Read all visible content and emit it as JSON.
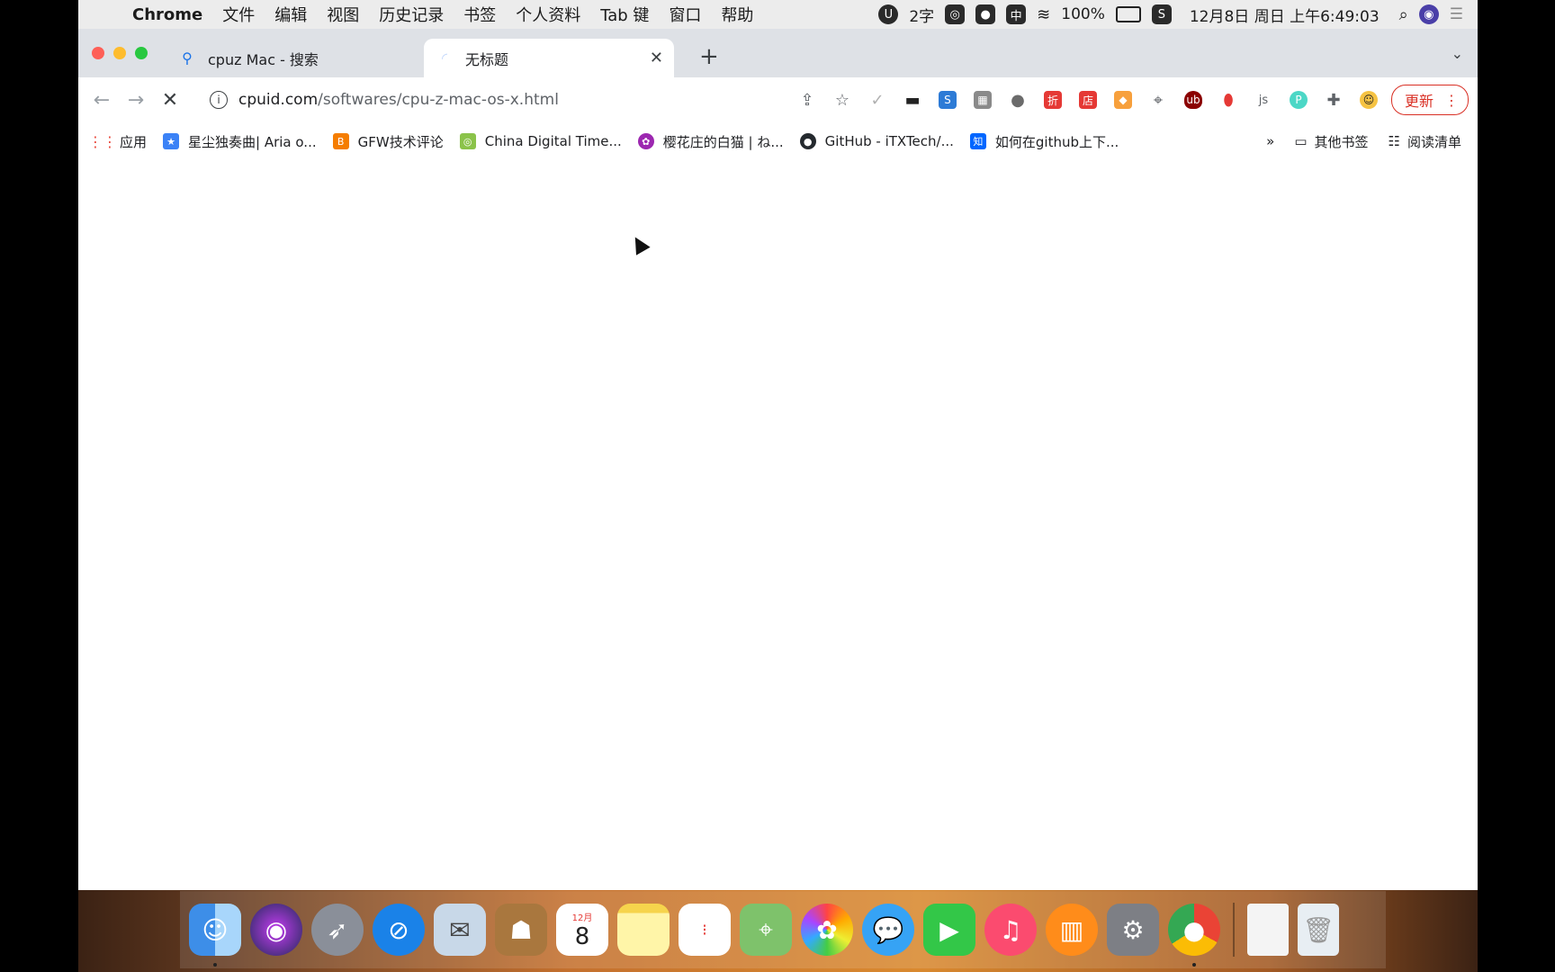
{
  "menubar": {
    "app": "Chrome",
    "items": [
      "文件",
      "编辑",
      "视图",
      "历史记录",
      "书签",
      "个人资料",
      "Tab 键",
      "窗口",
      "帮助"
    ],
    "status": {
      "wordcount": "2字",
      "input_method": "中",
      "battery": "100%",
      "datetime": "12月8日 周日 上午6:49:03"
    }
  },
  "tabs": [
    {
      "title": "cpuz Mac - 搜索",
      "icon": "search-icon",
      "active": false
    },
    {
      "title": "无标题",
      "icon": "loading-icon",
      "active": true
    }
  ],
  "toolbar": {
    "url_host": "cpuid.com",
    "url_path": "/softwares/cpu-z-mac-os-x.html",
    "update_label": "更新"
  },
  "bookmarks": {
    "items": [
      {
        "label": "应用",
        "icon": "apps-grid-icon",
        "color": "#e94235"
      },
      {
        "label": "星尘独奏曲| Aria o...",
        "icon": "anime-icon",
        "color": "#3b82f6"
      },
      {
        "label": "GFW技术评论",
        "icon": "blogger-icon",
        "color": "#f57d00"
      },
      {
        "label": "China Digital Time...",
        "icon": "cdt-icon",
        "color": "#8bc34a"
      },
      {
        "label": "樱花庄的白猫 | ね...",
        "icon": "sakura-icon",
        "color": "#9c27b0"
      },
      {
        "label": "GitHub - iTXTech/...",
        "icon": "github-icon",
        "color": "#24292e"
      },
      {
        "label": "如何在github上下...",
        "icon": "zhihu-icon",
        "color": "#0066ff"
      }
    ],
    "other_label": "其他书签",
    "reading_list_label": "阅读清单"
  },
  "dock": {
    "apps": [
      {
        "name": "finder-icon",
        "color": "#3d8ee8",
        "running": true
      },
      {
        "name": "siri-icon",
        "color": "#222a5a",
        "running": false
      },
      {
        "name": "launchpad-icon",
        "color": "#8a8f99",
        "running": false
      },
      {
        "name": "safari-icon",
        "color": "#1a82e8",
        "running": false
      },
      {
        "name": "mail-icon",
        "color": "#c8d8e8",
        "running": false
      },
      {
        "name": "contacts-icon",
        "color": "#a9773e",
        "running": false
      },
      {
        "name": "calendar-icon",
        "color": "#ffffff",
        "running": false,
        "text": "8",
        "month": "12月"
      },
      {
        "name": "notes-icon",
        "color": "#fff5a8",
        "running": false
      },
      {
        "name": "reminders-icon",
        "color": "#ffffff",
        "running": false
      },
      {
        "name": "maps-icon",
        "color": "#7ec26b",
        "running": false
      },
      {
        "name": "photos-icon",
        "color": "#ffffff",
        "running": false
      },
      {
        "name": "messages-icon",
        "color": "#36a3f5",
        "running": false
      },
      {
        "name": "facetime-icon",
        "color": "#33c748",
        "running": false
      },
      {
        "name": "music-icon",
        "color": "#fb4b6f",
        "running": false
      },
      {
        "name": "books-icon",
        "color": "#ff8c1a",
        "running": false
      },
      {
        "name": "system-preferences-icon",
        "color": "#7d7f85",
        "running": false
      },
      {
        "name": "chrome-icon",
        "color": "#ffffff",
        "running": true
      }
    ]
  }
}
